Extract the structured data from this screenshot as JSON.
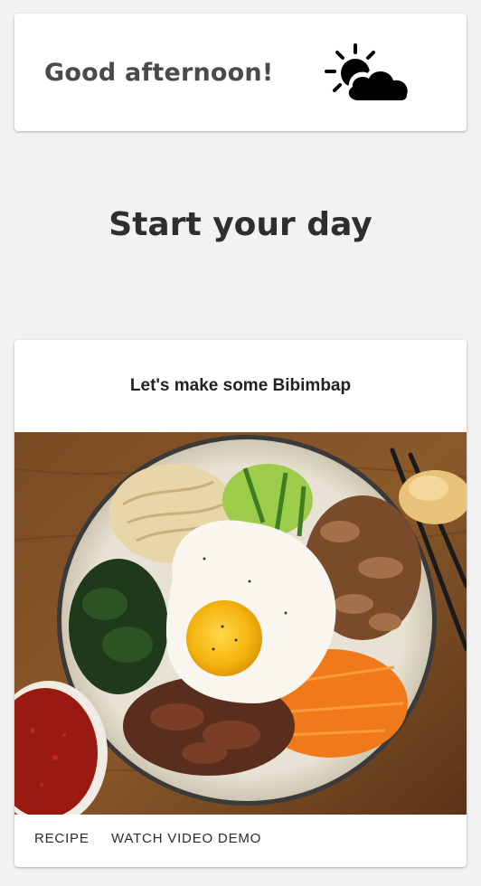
{
  "greeting": {
    "text": "Good afternoon!",
    "weather_icon": "partly-cloudy-sun-icon"
  },
  "headline": "Start your day",
  "recipe": {
    "title": "Let's make some Bibimbap",
    "image": "bibimbap-bowl-photo",
    "actions": {
      "recipe_label": "RECIPE",
      "video_label": "WATCH VIDEO DEMO"
    }
  }
}
